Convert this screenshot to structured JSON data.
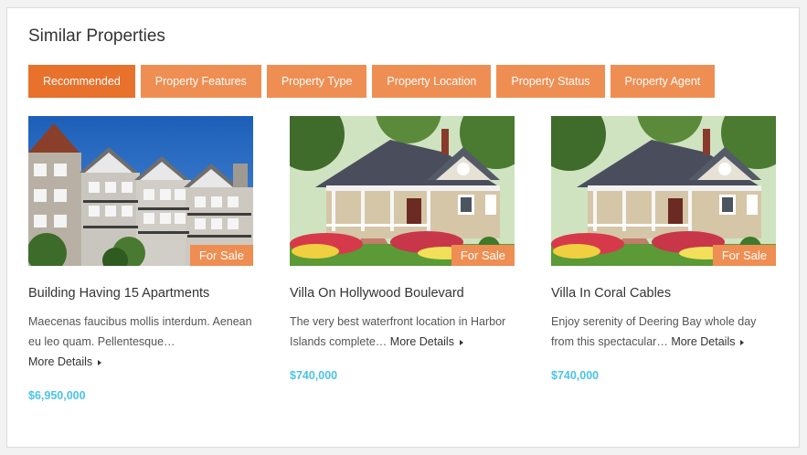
{
  "section": {
    "title": "Similar Properties"
  },
  "tabs": [
    {
      "label": "Recommended",
      "active": true
    },
    {
      "label": "Property Features",
      "active": false
    },
    {
      "label": "Property Type",
      "active": false
    },
    {
      "label": "Property Location",
      "active": false
    },
    {
      "label": "Property Status",
      "active": false
    },
    {
      "label": "Property Agent",
      "active": false
    }
  ],
  "properties": [
    {
      "status": "For Sale",
      "title": "Building Having 15 Apartments",
      "description": "Maecenas faucibus mollis interdum. Aenean eu leo quam. Pellentesque…",
      "more": "More Details",
      "price": "$6,950,000"
    },
    {
      "status": "For Sale",
      "title": "Villa On Hollywood Boulevard",
      "description": "The very best waterfront location in Harbor Islands complete…",
      "more": "More Details",
      "price": "$740,000"
    },
    {
      "status": "For Sale",
      "title": "Villa In Coral Cables",
      "description": "Enjoy serenity of Deering Bay whole day from this spectacular…",
      "more": "More Details",
      "price": "$740,000"
    }
  ],
  "colors": {
    "accent": "#ef8e52",
    "accent_active": "#e8712c",
    "price": "#4cc3e8"
  }
}
